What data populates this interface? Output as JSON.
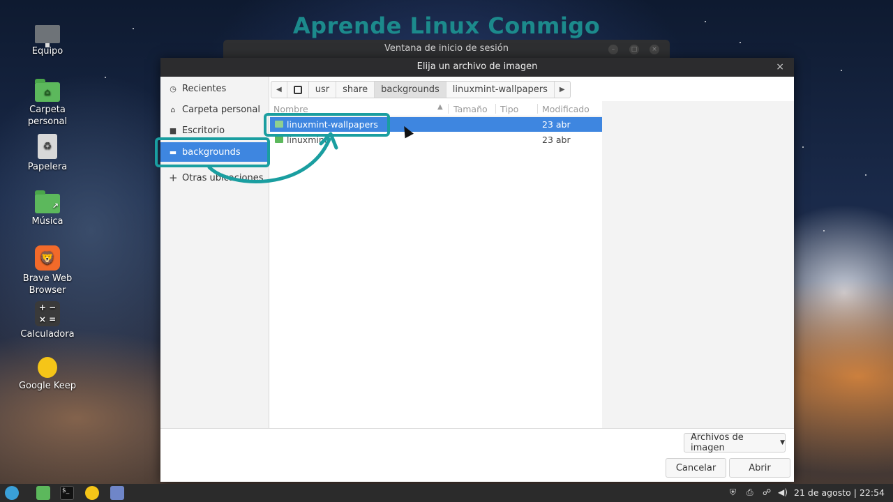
{
  "watermark": "Aprende Linux Conmigo",
  "desktop": {
    "icons": [
      {
        "label": "Equipo",
        "icon": "computer-icon"
      },
      {
        "label": "Carpeta personal",
        "icon": "home-folder-icon"
      },
      {
        "label": "Papelera",
        "icon": "trash-icon"
      },
      {
        "label": "Música",
        "icon": "music-folder-icon"
      },
      {
        "label": "Brave Web Browser",
        "icon": "brave-icon"
      },
      {
        "label": "Calculadora",
        "icon": "calculator-icon"
      },
      {
        "label": "Google Keep",
        "icon": "keep-icon"
      }
    ]
  },
  "background_window": {
    "title": "Ventana de inicio de sesión"
  },
  "dialog": {
    "title": "Elija un archivo de imagen",
    "sidebar": [
      {
        "label": "Recientes",
        "icon": "clock-icon"
      },
      {
        "label": "Carpeta personal",
        "icon": "home-icon"
      },
      {
        "label": "Escritorio",
        "icon": "desktop-icon"
      },
      {
        "label": "backgrounds",
        "icon": "folder-icon",
        "active": true
      },
      {
        "label": "Otras ubicaciones",
        "icon": "plus-icon"
      }
    ],
    "path": [
      "usr",
      "share",
      "backgrounds",
      "linuxmint-wallpapers"
    ],
    "path_active": "backgrounds",
    "columns": {
      "name": "Nombre",
      "size": "Tamaño",
      "type": "Tipo",
      "modified": "Modificado"
    },
    "files": [
      {
        "name": "linuxmint-wallpapers",
        "size": "",
        "type": "",
        "modified": "23 abr",
        "selected": true
      },
      {
        "name": "linuxmint",
        "size": "",
        "type": "",
        "modified": "23 abr",
        "selected": false
      }
    ],
    "filter": "Archivos de imagen",
    "cancel_label": "Cancelar",
    "open_label": "Abrir"
  },
  "taskbar": {
    "clock": "21 de agosto | 22:54"
  },
  "colors": {
    "accent": "#3e86e0",
    "highlight": "#1a9ea0",
    "watermark": "#1c8a8c"
  }
}
